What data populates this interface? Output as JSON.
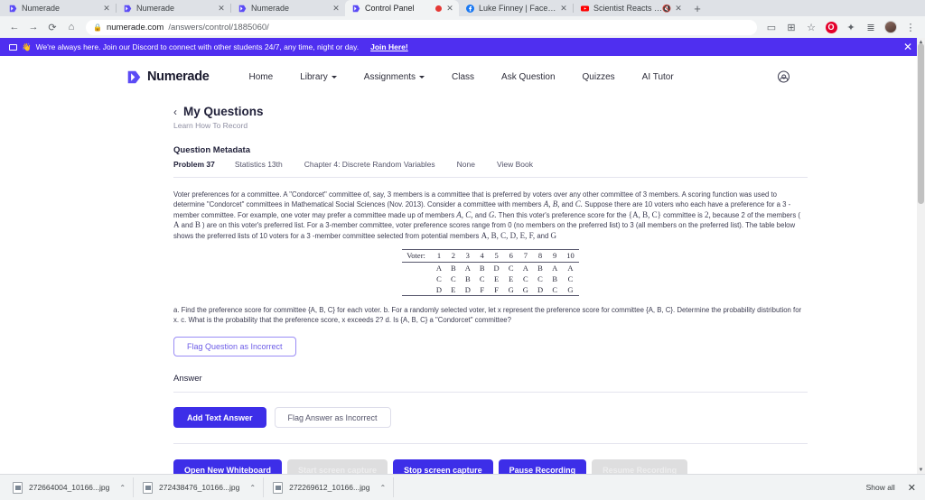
{
  "browser": {
    "tabs": [
      {
        "title": "Numerade",
        "favicon": "numerade-icon",
        "active": false,
        "recording": false,
        "muted": false
      },
      {
        "title": "Numerade",
        "favicon": "numerade-icon",
        "active": false,
        "recording": false,
        "muted": false
      },
      {
        "title": "Numerade",
        "favicon": "numerade-icon",
        "active": false,
        "recording": false,
        "muted": false
      },
      {
        "title": "Control Panel",
        "favicon": "numerade-icon",
        "active": true,
        "recording": true,
        "muted": false
      },
      {
        "title": "Luke Finney | Facebook",
        "favicon": "facebook-icon",
        "active": false,
        "recording": false,
        "muted": false
      },
      {
        "title": "Scientist Reacts to \"Fossil R...",
        "favicon": "youtube-icon",
        "active": false,
        "recording": false,
        "muted": true
      }
    ],
    "new_tab_label": "+",
    "nav": {
      "back": "←",
      "forward": "→",
      "reload": "⟳",
      "home": "⌂"
    },
    "omnibox": {
      "lock": "🔒",
      "host": "numerade.com",
      "path": "/answers/control/1885060/"
    },
    "toolbar_right": {
      "cast_label": "▭",
      "share_label": "⊞",
      "bookmark_label": "☆",
      "opera_label": "O",
      "extensions_label": "✦",
      "list_label": "≣",
      "menu_label": "⋮"
    }
  },
  "promo": {
    "icon": "chat-bubble-icon",
    "emoji": "👋",
    "text": "We're always here. Join our Discord to connect with other students 24/7, any time, night or day.",
    "link": "Join Here!",
    "close": "✕",
    "bg_color": "#4f2ff0"
  },
  "site_header": {
    "brand": "Numerade",
    "nav_items": [
      {
        "label": "Home",
        "has_caret": false
      },
      {
        "label": "Library",
        "has_caret": true
      },
      {
        "label": "Assignments",
        "has_caret": true
      },
      {
        "label": "Class",
        "has_caret": false
      },
      {
        "label": "Ask Question",
        "has_caret": false
      },
      {
        "label": "Quizzes",
        "has_caret": false
      },
      {
        "label": "AI Tutor",
        "has_caret": false
      }
    ],
    "account_icon": "account-circle-icon"
  },
  "page": {
    "back_chevron": "‹",
    "title": "My Questions",
    "subtitle": "Learn How To Record",
    "metadata_heading": "Question Metadata",
    "metadata": {
      "problem": "Problem 37",
      "book": "Statistics 13th",
      "chapter": "Chapter 4: Discrete Random Variables",
      "section": "None",
      "view_book": "View Book"
    },
    "question_text_1": "Voter preferences for a committee. A \"Condorcet\" committee of, say, 3 members is a committee that is preferred by voters over any other committee of 3 members. A scoring function was used to determine \"Condorcet\" committees in Mathematical Social Sciences (Nov. 2013). Consider a committee with members ",
    "question_vars_1": "A, B,",
    "question_text_1b": " and ",
    "question_vars_1b": "C.",
    "question_text_1c": " Suppose there are 10 voters who each have a preference for a 3 -member committee. For example, one voter may prefer a committee made up of members ",
    "question_vars_2": "A, C,",
    "question_text_2": " and ",
    "question_vars_2b": "G.",
    "question_text_2b": " Then this voter's preference score for the ",
    "question_vars_3": "{A, B, C}",
    "question_text_3": " committee is ",
    "question_num_3": "2,",
    "question_text_3b": " because 2 of the members ( ",
    "question_vars_3b": "A",
    "question_text_3c": " and ",
    "question_vars_3c": "B",
    "question_text_3d": " ) are on this voter's preferred list. For a 3-member committee, voter preference scores range from 0 (no members on the preferred list) to 3 (all members on the preferred list). The table below shows the preferred lists of 10 voters for a 3 -member committee selected from potential members ",
    "question_vars_4": "A, B, C, D, E, F,",
    "question_text_4": " and ",
    "question_vars_4b": "G",
    "question_parts": "a. Find the preference score for committee ",
    "question_parts_v1": "{A, B, C}",
    "question_parts_2": " for each voter. b. For a randomly selected voter, let ",
    "question_parts_v2": "x",
    "question_parts_3": " represent the preference score for committee ",
    "question_parts_v3": "{A, B, C}",
    "question_parts_4": ". Determine the probability distribution for ",
    "question_parts_v4": "x",
    "question_parts_5": ". c. What is the probability that the preference score, ",
    "question_parts_v5": "x",
    "question_parts_6": " exceeds ",
    "question_parts_n6": "2?",
    "question_parts_7": " d. Is ",
    "question_parts_v7": "{A, B, C}",
    "question_parts_8": " a \"Condorcet\" committee?",
    "flag_question_button": "Flag Question as Incorrect",
    "answer_label": "Answer",
    "add_text_answer_button": "Add Text Answer",
    "flag_answer_button": "Flag Answer as Incorrect",
    "record_buttons": [
      {
        "label": "Open New Whiteboard",
        "disabled": false
      },
      {
        "label": "Start screen capture",
        "disabled": true
      },
      {
        "label": "Stop screen capture",
        "disabled": false
      },
      {
        "label": "Pause Recording",
        "disabled": false
      },
      {
        "label": "Resume Recording",
        "disabled": true
      }
    ]
  },
  "voter_table": {
    "label": "Voter:",
    "voters": [
      "1",
      "2",
      "3",
      "4",
      "5",
      "6",
      "7",
      "8",
      "9",
      "10"
    ],
    "rows": [
      [
        "A",
        "B",
        "A",
        "B",
        "D",
        "C",
        "A",
        "B",
        "A",
        "A"
      ],
      [
        "C",
        "C",
        "B",
        "C",
        "E",
        "E",
        "C",
        "C",
        "B",
        "C"
      ],
      [
        "D",
        "E",
        "D",
        "F",
        "F",
        "G",
        "G",
        "D",
        "C",
        "G"
      ]
    ]
  },
  "downloads": {
    "items": [
      {
        "name": "272664004_10166...jpg",
        "icon": "image-file-icon",
        "caret": "⌃"
      },
      {
        "name": "272438476_10166...jpg",
        "icon": "image-file-icon",
        "caret": "⌃"
      },
      {
        "name": "272269612_10166...jpg",
        "icon": "image-file-icon",
        "caret": "⌃"
      }
    ],
    "show_all": "Show all",
    "close": "✕"
  }
}
